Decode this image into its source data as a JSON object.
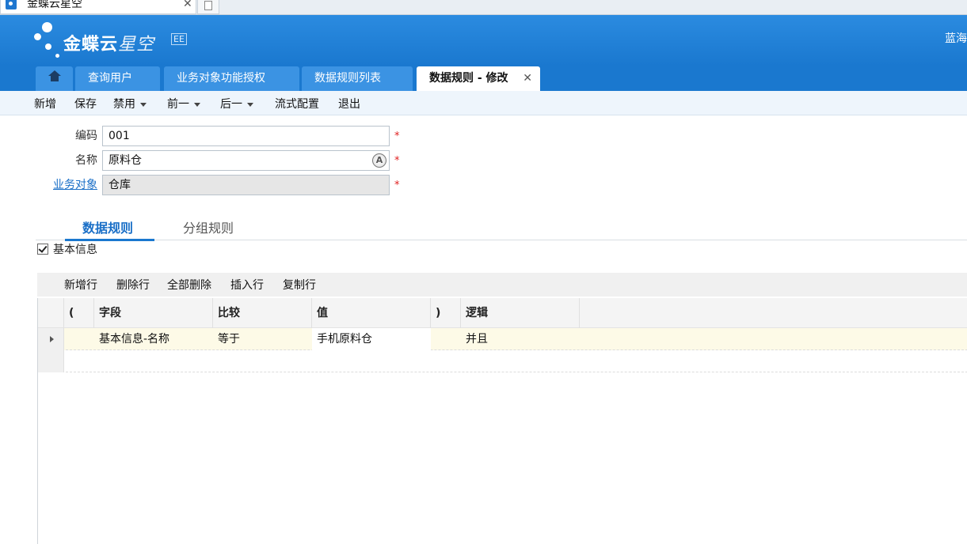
{
  "browser": {
    "tab_title": "金蝶云星空",
    "tab_close": "✕"
  },
  "header": {
    "logo_text": "金蝶云",
    "logo_text_light": "星空",
    "logo_badge": "EE",
    "user_name": "蓝海"
  },
  "tabs": [
    {
      "label": "查询用户"
    },
    {
      "label": "业务对象功能授权"
    },
    {
      "label": "数据规则列表"
    },
    {
      "label": "数据规则 - 修改",
      "close": "✕"
    }
  ],
  "toolbar": {
    "new": "新增",
    "save": "保存",
    "disable": "禁用",
    "prev": "前一",
    "next": "后一",
    "workflow": "流式配置",
    "exit": "退出"
  },
  "form": {
    "code_label": "编码",
    "code_value": "001",
    "name_label": "名称",
    "name_value": "原料仓",
    "object_label": "业务对象",
    "object_value": "仓库",
    "required_mark": "*",
    "lang_icon": "A"
  },
  "section_tabs": {
    "data_rule": "数据规则",
    "group_rule": "分组规则"
  },
  "basic_info": {
    "label": "基本信息",
    "checked": true
  },
  "grid_toolbar": {
    "add_row": "新增行",
    "delete_row": "删除行",
    "delete_all": "全部删除",
    "insert_row": "插入行",
    "copy_row": "复制行"
  },
  "grid": {
    "columns": {
      "open_paren": "(",
      "field": "字段",
      "compare": "比较",
      "value": "值",
      "close_paren": ")",
      "logic": "逻辑"
    },
    "rows": [
      {
        "open_paren": "",
        "field": "基本信息-名称",
        "compare": "等于",
        "value": "手机原料仓",
        "close_paren": "",
        "logic": "并且"
      }
    ]
  }
}
